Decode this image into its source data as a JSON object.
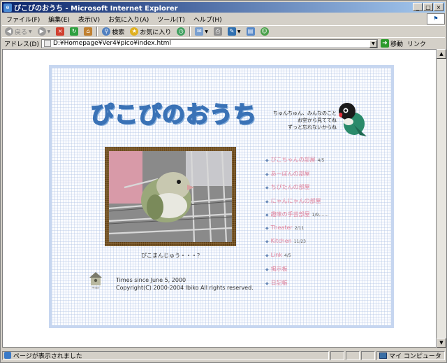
{
  "window": {
    "title": "ぴこぴのおうち - Microsoft Internet Explorer",
    "controls": [
      "_",
      "□",
      "×"
    ]
  },
  "menu": [
    "ファイル(F)",
    "編集(E)",
    "表示(V)",
    "お気に入り(A)",
    "ツール(T)",
    "ヘルプ(H)"
  ],
  "toolbar": {
    "back_label": "戻る",
    "search_label": "検索",
    "favorites_label": "お気に入り"
  },
  "address": {
    "label": "アドレス(D)",
    "value": "D:¥Homepage¥Ver4¥pico¥index.html",
    "go_label": "移動",
    "links_label": "リンク"
  },
  "page": {
    "logo": "ぴこぴのおうち",
    "bubble_lines": [
      "ちゅんちゅん、みんなのこと",
      "お空から見ててね",
      "ずっと忘れないからね"
    ],
    "caption": "ぴこまんじゅう・・・？",
    "nav": [
      {
        "label": "ぴこちゃんの部屋",
        "date": "4/5"
      },
      {
        "label": "あーぼんの部屋",
        "date": ""
      },
      {
        "label": "ちびたんの部屋",
        "date": ""
      },
      {
        "label": "にゃんにゃんの部屋",
        "date": ""
      },
      {
        "label": "趣味の手芸部屋",
        "date": "1/9,……"
      },
      {
        "label": "Theater",
        "date": "2/11"
      },
      {
        "label": "Kitchen",
        "date": "11/23"
      },
      {
        "label": "Link",
        "date": "4/5"
      },
      {
        "label": "掲示板",
        "date": ""
      },
      {
        "label": "日記帳",
        "date": ""
      }
    ],
    "footer_line1": "Times since June 5, 2000",
    "footer_line2": "Copyright(C) 2000-2004 Ibiko All rights reserved.",
    "house_text": "maps"
  },
  "status": {
    "text": "ページが表示されました",
    "zone": "マイ コンピュータ"
  },
  "colors": {
    "titlebar": "#0a246a",
    "nav_link": "#e0809a",
    "logo": "#3a72b6",
    "card_border": "#c6d6f0"
  }
}
